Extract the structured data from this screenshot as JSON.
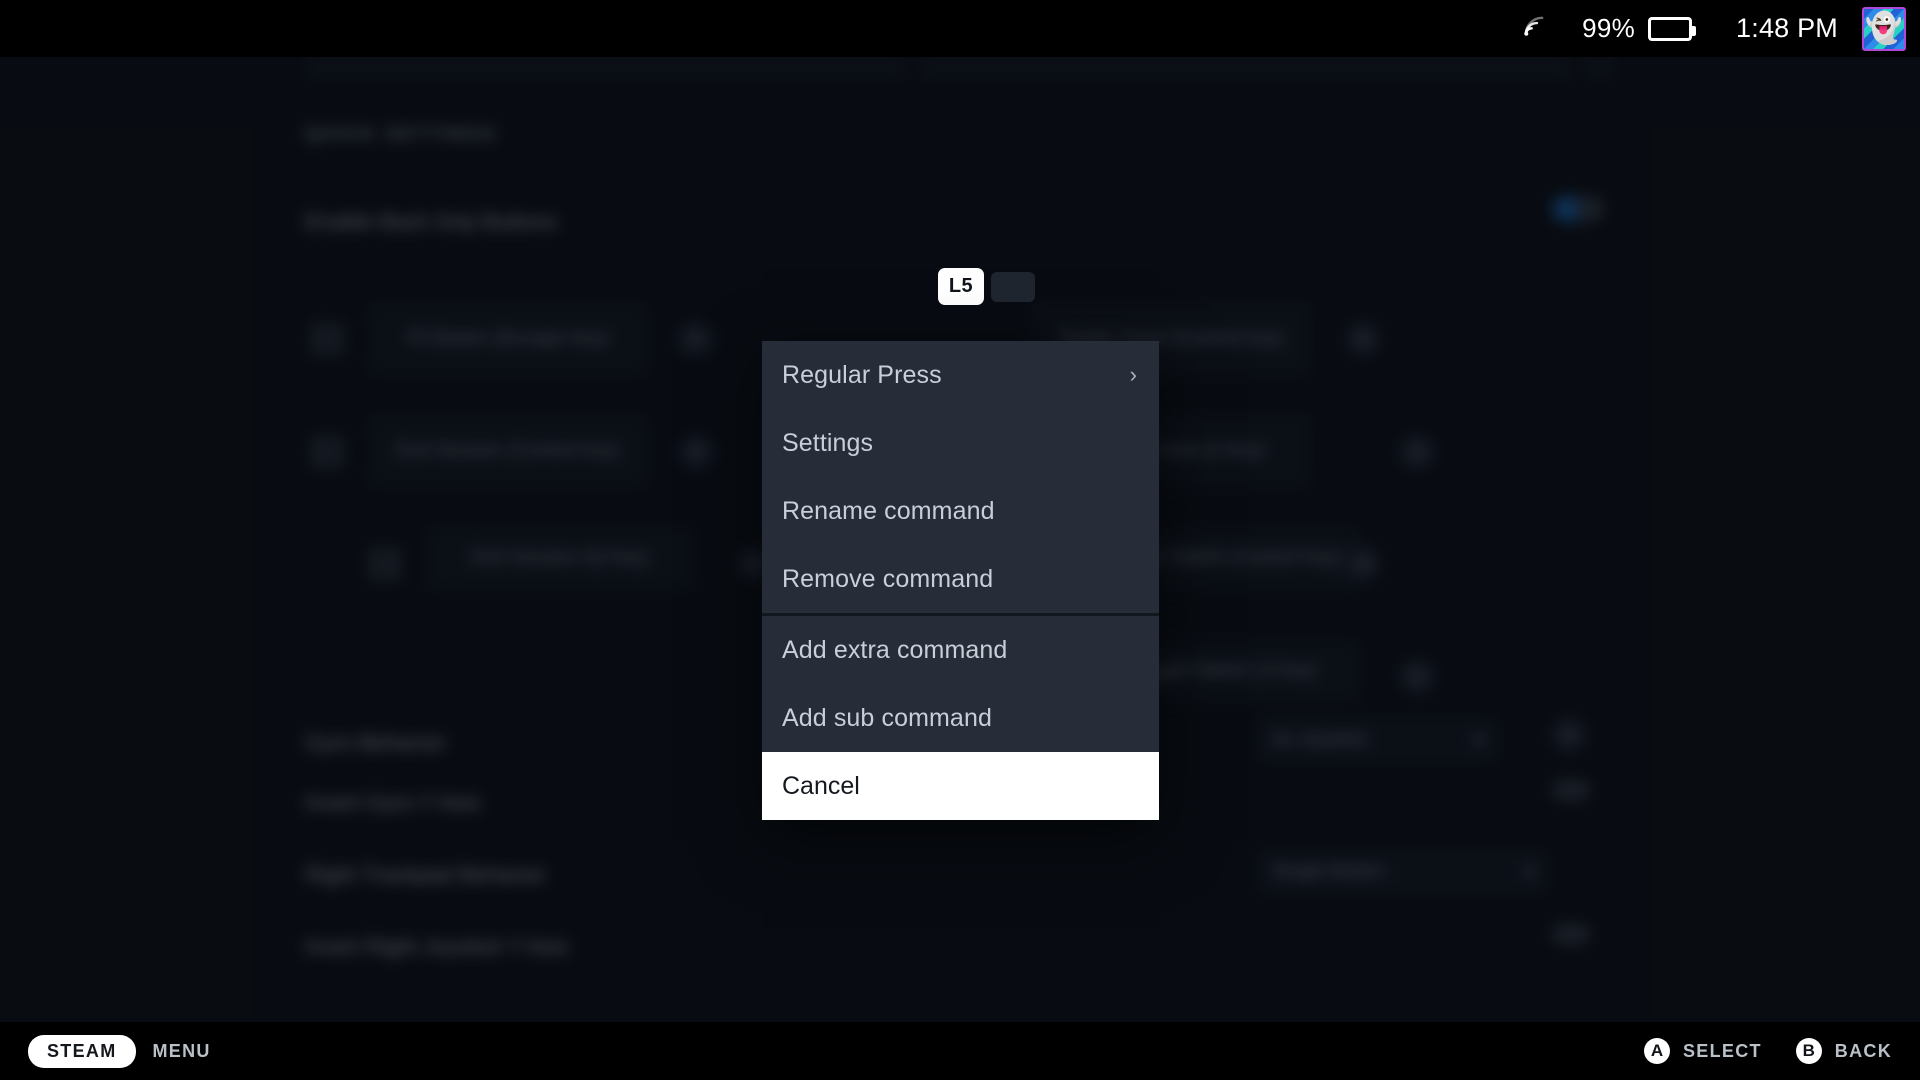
{
  "statusbar": {
    "wifi_icon": "wifi-icon",
    "battery_percent": "99%",
    "battery_icon": "battery-icon",
    "clock": "1:48 PM",
    "avatar_icon": "user-avatar"
  },
  "background": {
    "section_title": "QUICK SETTINGS",
    "rows": [
      {
        "label": "Enable Back Grip Buttons",
        "control": "toggle-on"
      },
      {
        "label": "Gyro Behavior",
        "control": "dropdown",
        "value": "As Joystick"
      },
      {
        "label": "Invert Gyro Y Axis",
        "control": "toggle-off"
      },
      {
        "label": "Right Trackpad Behavior",
        "control": "dropdown",
        "value": "Single Button"
      },
      {
        "label": "Invert Right Joystick Y Axis",
        "control": "toggle-off"
      }
    ],
    "commands": [
      {
        "text": "F5 Button (Escape Key)"
      },
      {
        "text": "Toggle Zoom (Control Key)"
      },
      {
        "text": "End Session (Control Key)"
      },
      {
        "text": "Toggle Screen (2 Key)"
      },
      {
        "text": "End Session (Q Key)"
      },
      {
        "text": "Toggle Switch (Control Key)"
      },
      {
        "text": "Toggle Switch (3 Key)"
      }
    ],
    "add_button_icon": "plus-icon"
  },
  "key_badge": {
    "label": "L5",
    "ghost_icon": "key-ghost"
  },
  "context_menu": {
    "groups": [
      {
        "items": [
          {
            "label": "Regular Press",
            "submenu": true,
            "chevron": "›"
          },
          {
            "label": "Settings",
            "submenu": false
          },
          {
            "label": "Rename command",
            "submenu": false
          },
          {
            "label": "Remove command",
            "submenu": false
          }
        ]
      },
      {
        "items": [
          {
            "label": "Add extra command",
            "submenu": false
          },
          {
            "label": "Add sub command",
            "submenu": false
          }
        ]
      }
    ],
    "cancel_label": "Cancel",
    "selected_item": "Cancel"
  },
  "bottombar": {
    "steam_label": "STEAM",
    "menu_label": "MENU",
    "hints": [
      {
        "button": "A",
        "label": "SELECT"
      },
      {
        "button": "B",
        "label": "BACK"
      }
    ]
  },
  "colors": {
    "accent_blue": "#1a6ec0",
    "battery_green": "#4ab54a",
    "menu_bg": "#262c38",
    "page_bg": "#0d1219",
    "selected_bg": "#ffffff"
  }
}
